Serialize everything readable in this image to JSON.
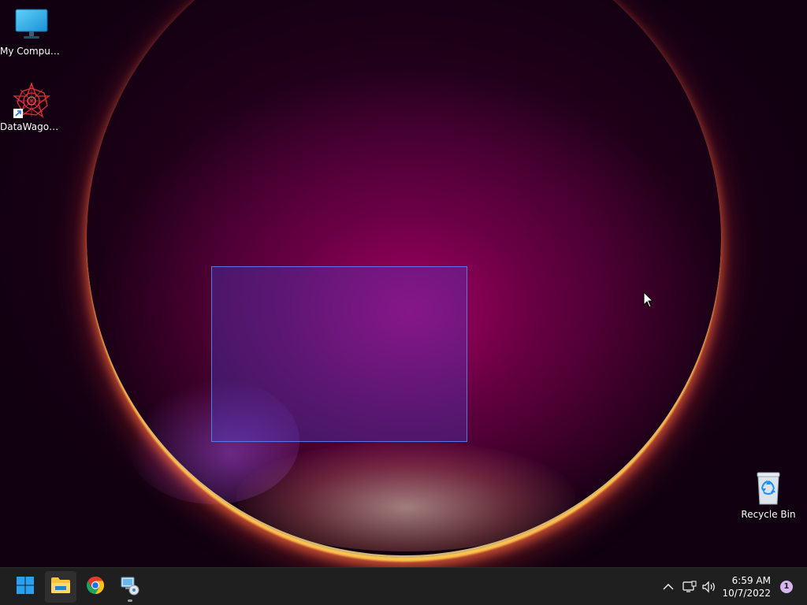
{
  "desktop": {
    "icons": [
      {
        "label": "My Computer",
        "icon": "monitor-icon"
      },
      {
        "label": "DataWagon...",
        "icon": "datawagon-app-icon"
      },
      {
        "label": "Recycle Bin",
        "icon": "recycle-bin-icon"
      }
    ]
  },
  "taskbar": {
    "pinned": [
      {
        "name": "Start",
        "icon": "windows-start-icon"
      },
      {
        "name": "File Explorer",
        "icon": "folder-icon"
      },
      {
        "name": "Google Chrome",
        "icon": "chrome-icon"
      },
      {
        "name": "Setup",
        "icon": "setup-installer-icon"
      }
    ],
    "tray": {
      "time": "6:59 AM",
      "date": "10/7/2022",
      "notification_count": "1"
    }
  },
  "colors": {
    "taskbar_bg": "#1f1f1f",
    "selection_fill": "#4646dc",
    "selection_border": "#5a82f0",
    "accent_blue": "#1e90ff"
  }
}
